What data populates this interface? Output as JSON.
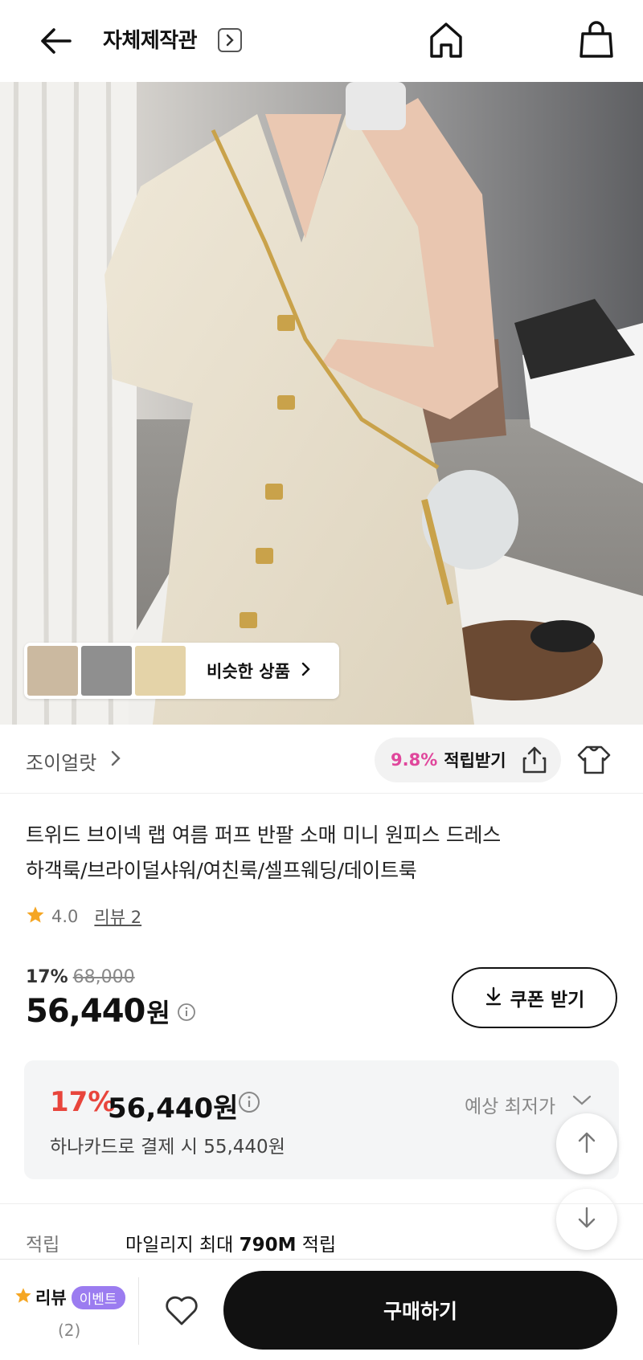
{
  "header": {
    "title": "자체제작관",
    "icons": [
      "back-arrow-icon",
      "chevron-right-icon",
      "home-icon",
      "shopping-bag-icon"
    ]
  },
  "similar": {
    "label": "비슷한 상품"
  },
  "shop": {
    "name": "조이얼랏",
    "reward_percent": "9.8%",
    "reward_label": "적립받기"
  },
  "product": {
    "title_line1": "트위드 브이넥 랩 여름 퍼프 반팔 소매 미니 원피스 드레스",
    "title_line2": "하객룩/브라이덜샤워/여친룩/셀프웨딩/데이트룩",
    "rating": "4.0",
    "review_link": "리뷰 2"
  },
  "price": {
    "discount_percent": "17%",
    "original": "68,000",
    "sale": "56,440",
    "unit": "원",
    "coupon_label": "쿠폰 받기"
  },
  "lowest": {
    "percent": "17%",
    "price": "56,440원",
    "label": "예상 최저가",
    "card_text": "하나카드로 결제 시 55,440원"
  },
  "mileage": {
    "key": "적립",
    "prefix": "마일리지 최대 ",
    "amount": "790M",
    "suffix": " 적립"
  },
  "bottom": {
    "review_label": "리뷰",
    "event_badge": "이벤트",
    "review_count": "(2)",
    "buy_label": "구매하기"
  },
  "colors": {
    "reward_pink": "#e0479c",
    "discount_red": "#e8453c",
    "event_purple": "#9b7cf0",
    "star_orange": "#f5a623"
  }
}
